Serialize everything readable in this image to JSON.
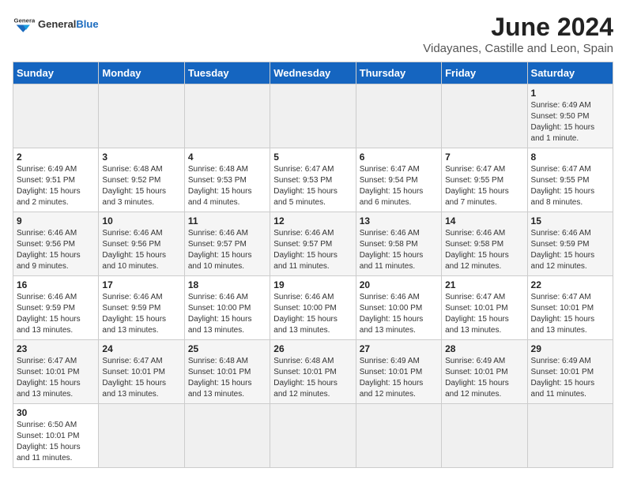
{
  "header": {
    "logo_general": "General",
    "logo_blue": "Blue",
    "month_title": "June 2024",
    "location": "Vidayanes, Castille and Leon, Spain"
  },
  "days_of_week": [
    "Sunday",
    "Monday",
    "Tuesday",
    "Wednesday",
    "Thursday",
    "Friday",
    "Saturday"
  ],
  "weeks": [
    [
      {
        "day": "",
        "info": ""
      },
      {
        "day": "",
        "info": ""
      },
      {
        "day": "",
        "info": ""
      },
      {
        "day": "",
        "info": ""
      },
      {
        "day": "",
        "info": ""
      },
      {
        "day": "",
        "info": ""
      },
      {
        "day": "1",
        "info": "Sunrise: 6:49 AM\nSunset: 9:50 PM\nDaylight: 15 hours\nand 1 minute."
      }
    ],
    [
      {
        "day": "2",
        "info": "Sunrise: 6:49 AM\nSunset: 9:51 PM\nDaylight: 15 hours\nand 2 minutes."
      },
      {
        "day": "3",
        "info": "Sunrise: 6:48 AM\nSunset: 9:52 PM\nDaylight: 15 hours\nand 3 minutes."
      },
      {
        "day": "4",
        "info": "Sunrise: 6:48 AM\nSunset: 9:53 PM\nDaylight: 15 hours\nand 4 minutes."
      },
      {
        "day": "5",
        "info": "Sunrise: 6:47 AM\nSunset: 9:53 PM\nDaylight: 15 hours\nand 5 minutes."
      },
      {
        "day": "6",
        "info": "Sunrise: 6:47 AM\nSunset: 9:54 PM\nDaylight: 15 hours\nand 6 minutes."
      },
      {
        "day": "7",
        "info": "Sunrise: 6:47 AM\nSunset: 9:55 PM\nDaylight: 15 hours\nand 7 minutes."
      },
      {
        "day": "8",
        "info": "Sunrise: 6:47 AM\nSunset: 9:55 PM\nDaylight: 15 hours\nand 8 minutes."
      }
    ],
    [
      {
        "day": "9",
        "info": "Sunrise: 6:46 AM\nSunset: 9:56 PM\nDaylight: 15 hours\nand 9 minutes."
      },
      {
        "day": "10",
        "info": "Sunrise: 6:46 AM\nSunset: 9:56 PM\nDaylight: 15 hours\nand 10 minutes."
      },
      {
        "day": "11",
        "info": "Sunrise: 6:46 AM\nSunset: 9:57 PM\nDaylight: 15 hours\nand 10 minutes."
      },
      {
        "day": "12",
        "info": "Sunrise: 6:46 AM\nSunset: 9:57 PM\nDaylight: 15 hours\nand 11 minutes."
      },
      {
        "day": "13",
        "info": "Sunrise: 6:46 AM\nSunset: 9:58 PM\nDaylight: 15 hours\nand 11 minutes."
      },
      {
        "day": "14",
        "info": "Sunrise: 6:46 AM\nSunset: 9:58 PM\nDaylight: 15 hours\nand 12 minutes."
      },
      {
        "day": "15",
        "info": "Sunrise: 6:46 AM\nSunset: 9:59 PM\nDaylight: 15 hours\nand 12 minutes."
      }
    ],
    [
      {
        "day": "16",
        "info": "Sunrise: 6:46 AM\nSunset: 9:59 PM\nDaylight: 15 hours\nand 13 minutes."
      },
      {
        "day": "17",
        "info": "Sunrise: 6:46 AM\nSunset: 9:59 PM\nDaylight: 15 hours\nand 13 minutes."
      },
      {
        "day": "18",
        "info": "Sunrise: 6:46 AM\nSunset: 10:00 PM\nDaylight: 15 hours\nand 13 minutes."
      },
      {
        "day": "19",
        "info": "Sunrise: 6:46 AM\nSunset: 10:00 PM\nDaylight: 15 hours\nand 13 minutes."
      },
      {
        "day": "20",
        "info": "Sunrise: 6:46 AM\nSunset: 10:00 PM\nDaylight: 15 hours\nand 13 minutes."
      },
      {
        "day": "21",
        "info": "Sunrise: 6:47 AM\nSunset: 10:01 PM\nDaylight: 15 hours\nand 13 minutes."
      },
      {
        "day": "22",
        "info": "Sunrise: 6:47 AM\nSunset: 10:01 PM\nDaylight: 15 hours\nand 13 minutes."
      }
    ],
    [
      {
        "day": "23",
        "info": "Sunrise: 6:47 AM\nSunset: 10:01 PM\nDaylight: 15 hours\nand 13 minutes."
      },
      {
        "day": "24",
        "info": "Sunrise: 6:47 AM\nSunset: 10:01 PM\nDaylight: 15 hours\nand 13 minutes."
      },
      {
        "day": "25",
        "info": "Sunrise: 6:48 AM\nSunset: 10:01 PM\nDaylight: 15 hours\nand 13 minutes."
      },
      {
        "day": "26",
        "info": "Sunrise: 6:48 AM\nSunset: 10:01 PM\nDaylight: 15 hours\nand 12 minutes."
      },
      {
        "day": "27",
        "info": "Sunrise: 6:49 AM\nSunset: 10:01 PM\nDaylight: 15 hours\nand 12 minutes."
      },
      {
        "day": "28",
        "info": "Sunrise: 6:49 AM\nSunset: 10:01 PM\nDaylight: 15 hours\nand 12 minutes."
      },
      {
        "day": "29",
        "info": "Sunrise: 6:49 AM\nSunset: 10:01 PM\nDaylight: 15 hours\nand 11 minutes."
      }
    ],
    [
      {
        "day": "30",
        "info": "Sunrise: 6:50 AM\nSunset: 10:01 PM\nDaylight: 15 hours\nand 11 minutes."
      },
      {
        "day": "",
        "info": ""
      },
      {
        "day": "",
        "info": ""
      },
      {
        "day": "",
        "info": ""
      },
      {
        "day": "",
        "info": ""
      },
      {
        "day": "",
        "info": ""
      },
      {
        "day": "",
        "info": ""
      }
    ]
  ]
}
